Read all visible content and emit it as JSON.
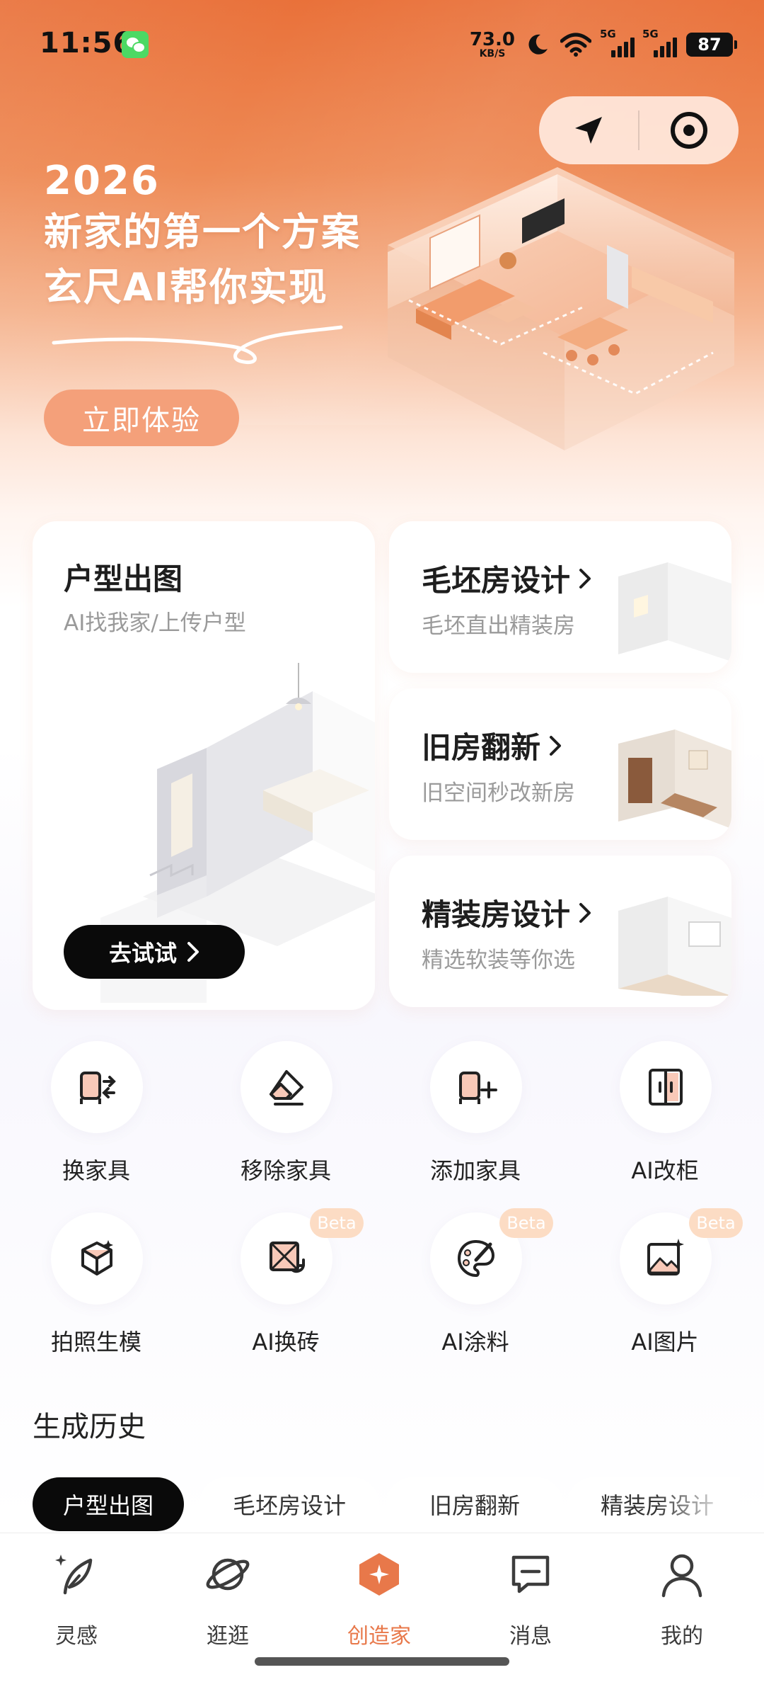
{
  "status_bar": {
    "time": "11:56",
    "app_icon": "wechat-icon",
    "net_speed_value": "73.0",
    "net_speed_unit": "KB/S",
    "signal_1_tag": "5G",
    "signal_2_tag": "5G",
    "battery": "87"
  },
  "capsule": {
    "left_icon": "location-arrow-icon",
    "right_icon": "target-icon"
  },
  "banner": {
    "year": "2026",
    "line1": "新家的第一个方案",
    "line2": "玄尺AI帮你实现",
    "cta": "立即体验"
  },
  "cards": {
    "main": {
      "title": "户型出图",
      "subtitle": "AI找我家/上传户型",
      "button": "去试试"
    },
    "side": [
      {
        "title": "毛坯房设计",
        "subtitle": "毛坯直出精装房"
      },
      {
        "title": "旧房翻新",
        "subtitle": "旧空间秒改新房"
      },
      {
        "title": "精装房设计",
        "subtitle": "精选软装等你选"
      }
    ]
  },
  "tools": [
    {
      "label": "换家具",
      "icon": "swap-furniture-icon",
      "badge": ""
    },
    {
      "label": "移除家具",
      "icon": "eraser-icon",
      "badge": ""
    },
    {
      "label": "添加家具",
      "icon": "add-furniture-icon",
      "badge": ""
    },
    {
      "label": "AI改柜",
      "icon": "cabinet-icon",
      "badge": ""
    },
    {
      "label": "拍照生模",
      "icon": "photo-to-model-icon",
      "badge": ""
    },
    {
      "label": "AI换砖",
      "icon": "tile-swap-icon",
      "badge": "Beta"
    },
    {
      "label": "AI涂料",
      "icon": "palette-icon",
      "badge": "Beta"
    },
    {
      "label": "AI图片",
      "icon": "ai-image-icon",
      "badge": "Beta"
    }
  ],
  "history": {
    "title": "生成历史",
    "tabs": [
      "户型出图",
      "毛坯房设计",
      "旧房翻新",
      "精装房设计"
    ],
    "active_tab": "户型出图"
  },
  "bottom_nav": {
    "items": [
      {
        "label": "灵感",
        "icon": "inspiration-feather-icon"
      },
      {
        "label": "逛逛",
        "icon": "planet-icon"
      },
      {
        "label": "创造家",
        "icon": "creator-icon"
      },
      {
        "label": "消息",
        "icon": "message-icon"
      },
      {
        "label": "我的",
        "icon": "profile-icon"
      }
    ],
    "active": "创造家"
  },
  "colors": {
    "brand_orange": "#e8784a",
    "hero_top": "#e9713a",
    "cta_button": "#f4a07a",
    "beta_badge": "#fcdcc4",
    "dark_button": "#0a0a0a"
  }
}
